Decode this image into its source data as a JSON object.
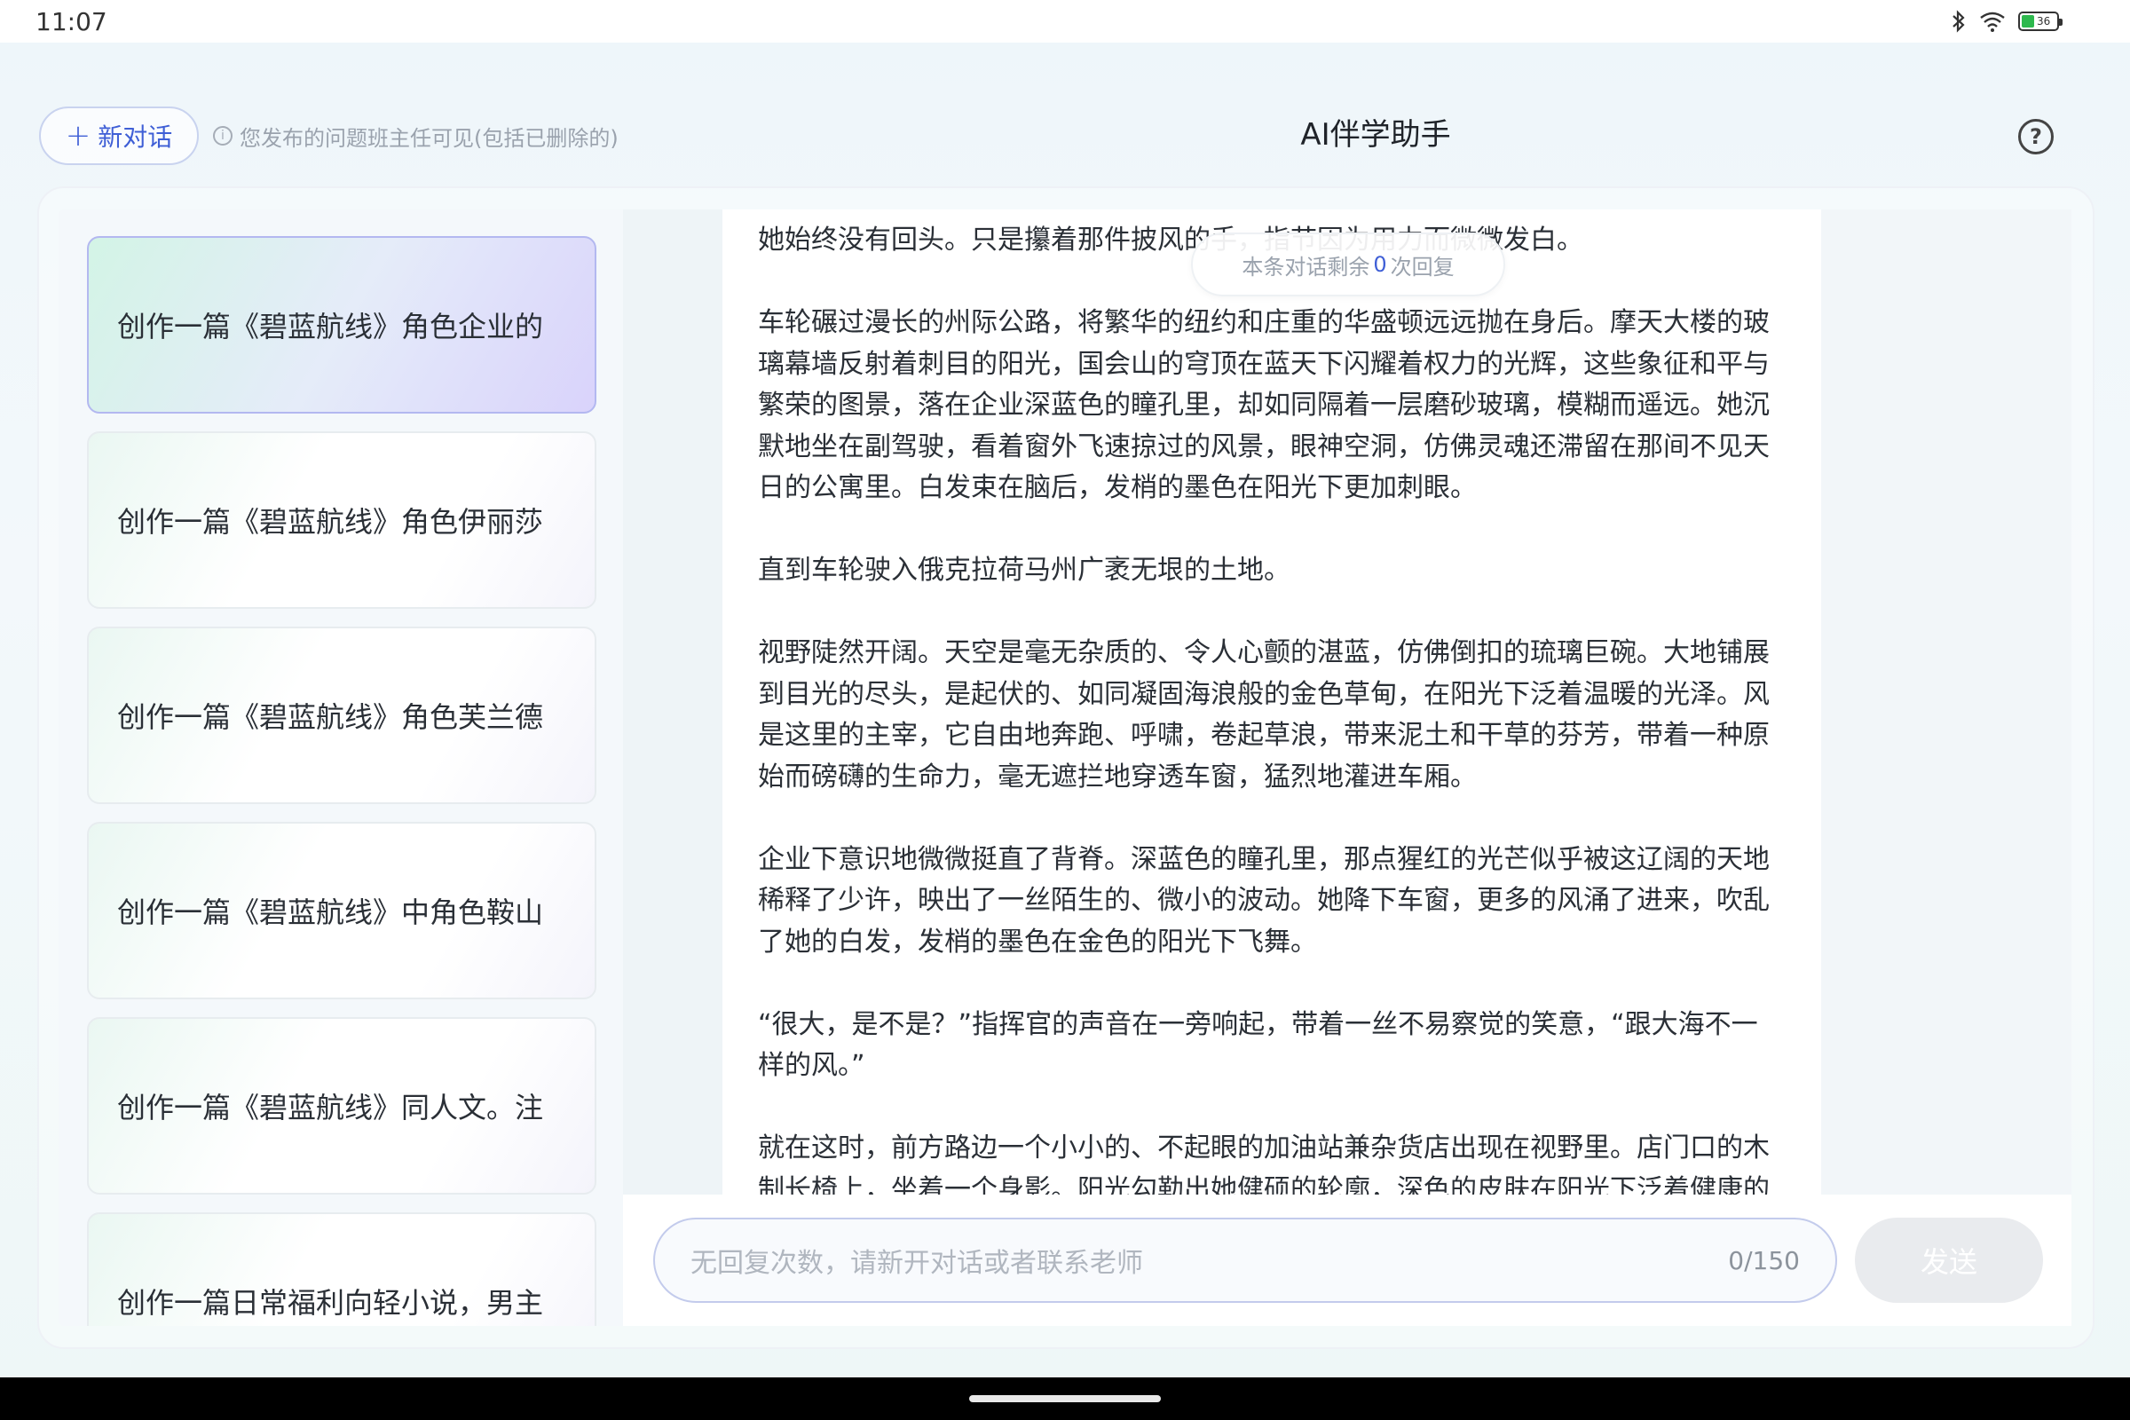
{
  "status_bar": {
    "time": "11:07",
    "battery_level": "36",
    "icons": [
      "bluetooth-icon",
      "wifi-icon",
      "battery-icon"
    ]
  },
  "header": {
    "new_chat_label": "新对话",
    "notice": "您发布的问题班主任可见(包括已删除的)",
    "title": "AI伴学助手"
  },
  "sidebar": {
    "items": [
      {
        "label": "创作一篇《碧蓝航线》角色企业的",
        "active": true
      },
      {
        "label": "创作一篇《碧蓝航线》角色伊丽莎",
        "active": false
      },
      {
        "label": "创作一篇《碧蓝航线》角色芙兰德",
        "active": false
      },
      {
        "label": "创作一篇《碧蓝航线》中角色鞍山",
        "active": false
      },
      {
        "label": "创作一篇《碧蓝航线》同人文。注",
        "active": false
      },
      {
        "label": "创作一篇日常福利向轻小说，男主",
        "active": false
      }
    ]
  },
  "toast": {
    "prefix": "本条对话剩余",
    "count": "0",
    "suffix": "次回复"
  },
  "message": {
    "paragraphs": [
      "她始终没有回头。只是攥着那件披风的手，指节因为用力而微微发白。",
      "车轮碾过漫长的州际公路，将繁华的纽约和庄重的华盛顿远远抛在身后。摩天大楼的玻璃幕墙反射着刺目的阳光，国会山的穹顶在蓝天下闪耀着权力的光辉，这些象征和平与繁荣的图景，落在企业深蓝色的瞳孔里，却如同隔着一层磨砂玻璃，模糊而遥远。她沉默地坐在副驾驶，看着窗外飞速掠过的风景，眼神空洞，仿佛灵魂还滞留在那间不见天日的公寓里。白发束在脑后，发梢的墨色在阳光下更加刺眼。",
      "直到车轮驶入俄克拉荷马州广袤无垠的土地。",
      "视野陡然开阔。天空是毫无杂质的、令人心颤的湛蓝，仿佛倒扣的琉璃巨碗。大地铺展到目光的尽头，是起伏的、如同凝固海浪般的金色草甸，在阳光下泛着温暖的光泽。风是这里的主宰，它自由地奔跑、呼啸，卷起草浪，带来泥土和干草的芬芳，带着一种原始而磅礴的生命力，毫无遮拦地穿透车窗，猛烈地灌进车厢。",
      "企业下意识地微微挺直了背脊。深蓝色的瞳孔里，那点猩红的光芒似乎被这辽阔的天地稀释了少许，映出了一丝陌生的、微小的波动。她降下车窗，更多的风涌了进来，吹乱了她的白发，发梢的墨色在金色的阳光下飞舞。",
      "“很大，是不是？”指挥官的声音在一旁响起，带着一丝不易察觉的笑意，“跟大海不一样的风。”",
      "就在这时，前方路边一个小小的、不起眼的加油站兼杂货店出现在视野里。店门口的木制长椅上，坐着一个身影。阳光勾勒出她健硕的轮廓，深色的皮肤在阳光下泛着健康的光泽。"
    ]
  },
  "input": {
    "placeholder": "无回复次数，请新开对话或者联系老师",
    "char_count": "0/150",
    "send_label": "发送"
  }
}
